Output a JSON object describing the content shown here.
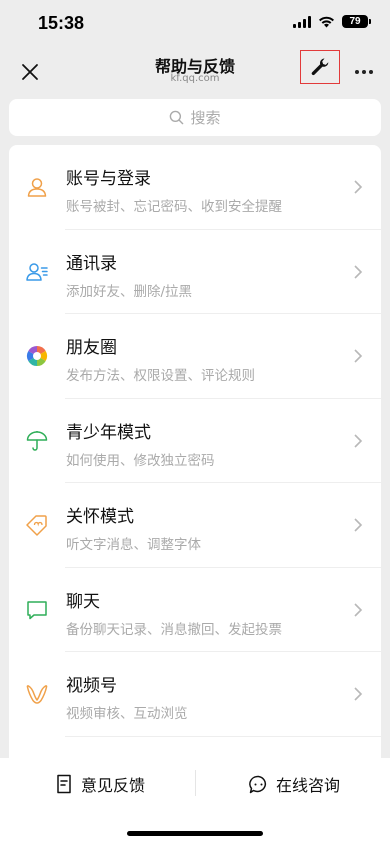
{
  "status_bar": {
    "time": "15:38",
    "battery": "79"
  },
  "nav": {
    "title": "帮助与反馈",
    "subtitle": "kf.qq.com"
  },
  "search": {
    "placeholder": "搜索"
  },
  "items": [
    {
      "title": "账号与登录",
      "desc": "账号被封、忘记密码、收到安全提醒",
      "icon": "person-icon",
      "color": "#f0a14a"
    },
    {
      "title": "通讯录",
      "desc": "添加好友、删除/拉黑",
      "icon": "contacts-icon",
      "color": "#3a9ae8"
    },
    {
      "title": "朋友圈",
      "desc": "发布方法、权限设置、评论规则",
      "icon": "moments-icon",
      "color": "#f26f4c"
    },
    {
      "title": "青少年模式",
      "desc": "如何使用、修改独立密码",
      "icon": "umbrella-icon",
      "color": "#2fae58"
    },
    {
      "title": "关怀模式",
      "desc": "听文字消息、调整字体",
      "icon": "care-tag-icon",
      "color": "#f0a14a"
    },
    {
      "title": "聊天",
      "desc": "备份聊天记录、消息撤回、发起投票",
      "icon": "chat-bubble-icon",
      "color": "#2fae58"
    },
    {
      "title": "视频号",
      "desc": "视频审核、互动浏览",
      "icon": "channels-icon",
      "color": "#f0a14a"
    }
  ],
  "bottom": {
    "feedback_label": "意见反馈",
    "consult_label": "在线咨询"
  }
}
